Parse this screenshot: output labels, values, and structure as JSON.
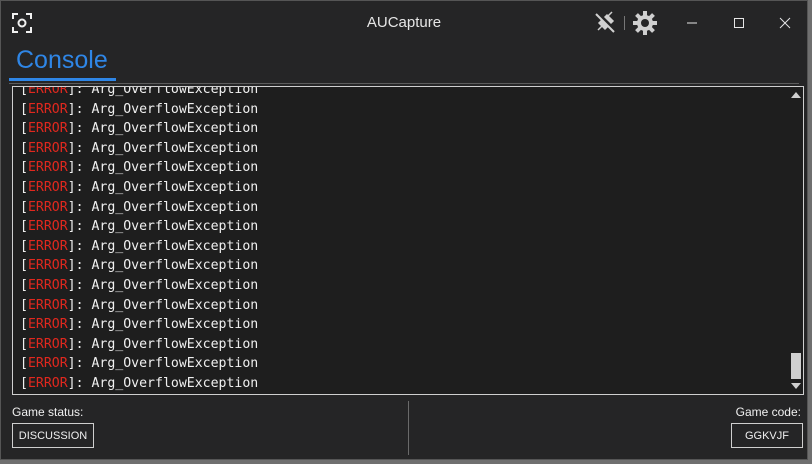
{
  "window": {
    "title": "AUCapture"
  },
  "icons": {
    "app": "capture-icon",
    "plug": "plug-disconnected-icon",
    "gear": "gear-icon",
    "minimize": "minimize-icon",
    "maximize": "maximize-icon",
    "close": "close-icon"
  },
  "tabs": [
    {
      "label": "Console",
      "active": true
    }
  ],
  "console": {
    "open_bracket": "[",
    "level": "ERROR",
    "separator": "]: ",
    "message": "Arg_OverflowException",
    "line_count": 16
  },
  "footer": {
    "game_status_label": "Game status:",
    "game_status_value": "DISCUSSION",
    "game_code_label": "Game code:",
    "game_code_value": "GGKVJF"
  },
  "colors": {
    "accent": "#2f86e6",
    "error": "#e0281e",
    "background": "#252526"
  }
}
